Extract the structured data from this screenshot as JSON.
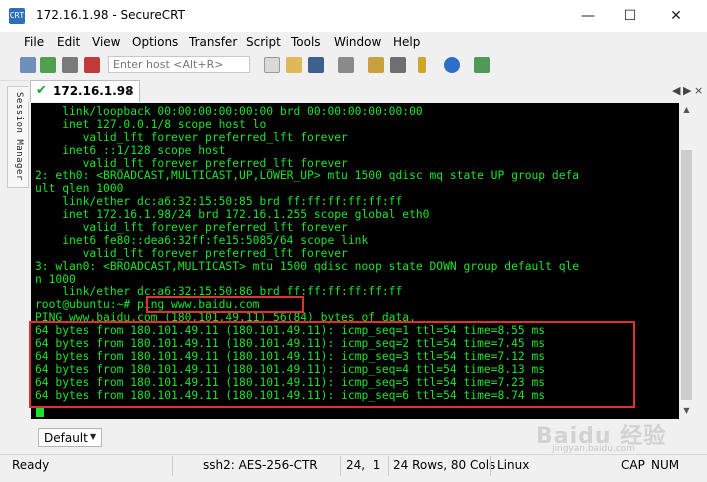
{
  "window": {
    "title": "172.16.1.98 - SecureCRT",
    "minimize": "—",
    "maximize": "☐",
    "close": "✕"
  },
  "menu": [
    "File",
    "Edit",
    "View",
    "Options",
    "Transfer",
    "Script",
    "Tools",
    "Window",
    "Help"
  ],
  "toolbar": {
    "host_placeholder": "Enter host <Alt+R>"
  },
  "session_manager": {
    "label": "Session Manager"
  },
  "tab": {
    "label": "172.16.1.98",
    "check": "✔",
    "close": "×",
    "nav_left": "◀",
    "nav_right": "▶",
    "nav_close": "×"
  },
  "terminal": {
    "lines": [
      "    link/loopback 00:00:00:00:00:00 brd 00:00:00:00:00:00",
      "    inet 127.0.0.1/8 scope host lo",
      "       valid_lft forever preferred_lft forever",
      "    inet6 ::1/128 scope host",
      "       valid_lft forever preferred_lft forever",
      "2: eth0: <BROADCAST,MULTICAST,UP,LOWER_UP> mtu 1500 qdisc mq state UP group defa",
      "ult qlen 1000",
      "    link/ether dc:a6:32:15:50:85 brd ff:ff:ff:ff:ff:ff",
      "    inet 172.16.1.98/24 brd 172.16.1.255 scope global eth0",
      "       valid_lft forever preferred_lft forever",
      "    inet6 fe80::dea6:32ff:fe15:5085/64 scope link",
      "       valid_lft forever preferred_lft forever",
      "3: wlan0: <BROADCAST,MULTICAST> mtu 1500 qdisc noop state DOWN group default qle",
      "n 1000",
      "    link/ether dc:a6:32:15:50:86 brd ff:ff:ff:ff:ff:ff",
      "root@ubuntu:~# ping www.baidu.com",
      "PING www.baidu.com (180.101.49.11) 56(84) bytes of data.",
      "64 bytes from 180.101.49.11 (180.101.49.11): icmp_seq=1 ttl=54 time=8.55 ms",
      "64 bytes from 180.101.49.11 (180.101.49.11): icmp_seq=2 ttl=54 time=7.45 ms",
      "64 bytes from 180.101.49.11 (180.101.49.11): icmp_seq=3 ttl=54 time=7.12 ms",
      "64 bytes from 180.101.49.11 (180.101.49.11): icmp_seq=4 ttl=54 time=8.13 ms",
      "64 bytes from 180.101.49.11 (180.101.49.11): icmp_seq=5 ttl=54 time=7.23 ms",
      "64 bytes from 180.101.49.11 (180.101.49.11): icmp_seq=6 ttl=54 time=8.74 ms"
    ]
  },
  "button_bar": {
    "default_label": "Default",
    "arrow": "▼"
  },
  "status": {
    "ready": "Ready",
    "cipher": "ssh2: AES-256-CTR",
    "cursor_pos": "24,  1",
    "size": "24 Rows, 80 Cols",
    "terminal_type": "Linux",
    "caps": "CAP",
    "num": "NUM"
  },
  "watermark": {
    "main": "Baidu 经验",
    "sub": "jingyan.baidu.com"
  },
  "colors": {
    "terminal_fg": "#18e52a",
    "terminal_bg": "#000000",
    "highlight": "#e0312c"
  }
}
